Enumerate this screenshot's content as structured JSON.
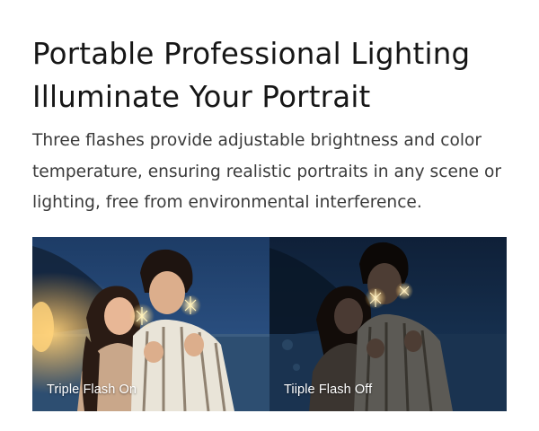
{
  "heading": {
    "line1": "Portable Professional Lighting",
    "line2": "Illuminate Your Portrait"
  },
  "description": {
    "line1": "Three flashes provide adjustable brightness and color",
    "line2": "temperature, ensuring realistic portraits in any scene or",
    "line3": "lighting, free from environmental interference."
  },
  "comparison": {
    "left_caption": "Triple Flash On",
    "right_caption": "Tiiple Flash Off"
  },
  "colors": {
    "heading": "#161616",
    "body_text": "#3a3a3a",
    "caption": "#ffffff",
    "night_sky": "#1c3a63",
    "night_sky_dark": "#0f2036"
  }
}
